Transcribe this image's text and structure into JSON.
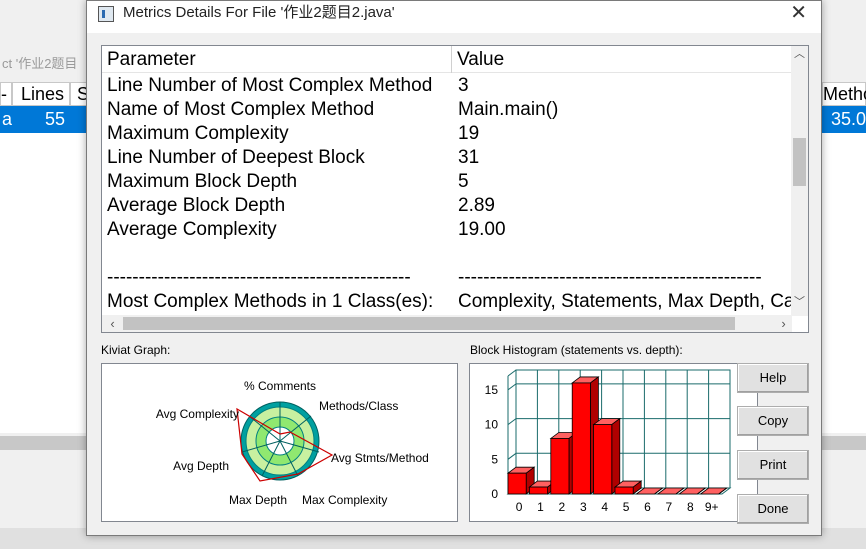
{
  "background": {
    "title_fragment": "ct '作业2题目",
    "col_left_fragment": "-",
    "col_lines": "Lines",
    "col_s_fragment": "S",
    "col_right_fragment": "Metho",
    "row_left_fragment": "a",
    "row_lines": "55",
    "row_right_fragment": "35.0"
  },
  "dialog": {
    "title": "Metrics Details For File '作业2题目2.java'",
    "close_symbol": "✕"
  },
  "table": {
    "columns": [
      "Parameter",
      "Value"
    ],
    "rows": [
      {
        "parameter": "Line Number of Most Complex Method",
        "value": "3"
      },
      {
        "parameter": "Name of Most Complex Method",
        "value": "Main.main()"
      },
      {
        "parameter": "Maximum Complexity",
        "value": "19"
      },
      {
        "parameter": "Line Number of Deepest Block",
        "value": "31"
      },
      {
        "parameter": "Maximum Block Depth",
        "value": "5"
      },
      {
        "parameter": "Average Block Depth",
        "value": "2.89"
      },
      {
        "parameter": "Average Complexity",
        "value": "19.00"
      },
      {
        "parameter": "",
        "value": ""
      },
      {
        "parameter": "------------------------------------------------",
        "value": "------------------------------------------------"
      },
      {
        "parameter": "Most Complex Methods in 1 Class(es):",
        "value": "Complexity, Statements, Max Depth, Ca"
      }
    ]
  },
  "kiviat": {
    "label": "Kiviat Graph:",
    "axes": [
      "% Comments",
      "Methods/Class",
      "Avg Stmts/Method",
      "Max Complexity",
      "Max Depth",
      "Avg Depth",
      "Avg Complexity"
    ]
  },
  "histogram": {
    "label": "Block Histogram (statements vs. depth):",
    "y_ticks": [
      "0",
      "5",
      "10",
      "15"
    ],
    "x_labels": [
      "0",
      "1",
      "2",
      "3",
      "4",
      "5",
      "6",
      "7",
      "8",
      "9+"
    ],
    "values": [
      3,
      1,
      8,
      16,
      10,
      1,
      0,
      0,
      0,
      0
    ],
    "ylim": [
      0,
      17
    ],
    "bar_color": "#ff0000",
    "grid_color": "#1a6b6b"
  },
  "buttons": {
    "help": "Help",
    "copy": "Copy",
    "print": "Print",
    "done": "Done"
  }
}
